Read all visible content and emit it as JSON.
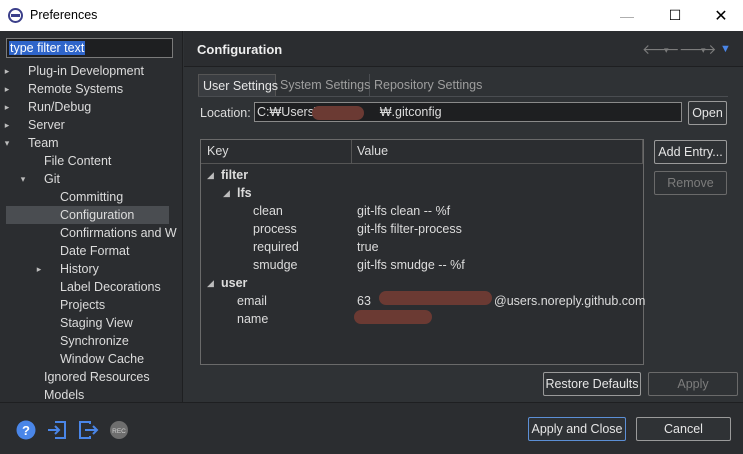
{
  "window": {
    "title": "Preferences",
    "minimize": "—",
    "maximize": "☐",
    "close": "✕"
  },
  "filter": {
    "text": "type filter text"
  },
  "tree": [
    {
      "label": "Plug-in Development",
      "depth": 0,
      "twisty": "▸"
    },
    {
      "label": "Remote Systems",
      "depth": 0,
      "twisty": "▸"
    },
    {
      "label": "Run/Debug",
      "depth": 0,
      "twisty": "▸"
    },
    {
      "label": "Server",
      "depth": 0,
      "twisty": "▸"
    },
    {
      "label": "Team",
      "depth": 0,
      "twisty": "▾"
    },
    {
      "label": "File Content",
      "depth": 1,
      "twisty": ""
    },
    {
      "label": "Git",
      "depth": 1,
      "twisty": "▾"
    },
    {
      "label": "Committing",
      "depth": 2,
      "twisty": ""
    },
    {
      "label": "Configuration",
      "depth": 2,
      "twisty": "",
      "selected": true
    },
    {
      "label": "Confirmations and W",
      "depth": 2,
      "twisty": ""
    },
    {
      "label": "Date Format",
      "depth": 2,
      "twisty": ""
    },
    {
      "label": "History",
      "depth": 2,
      "twisty": "▸"
    },
    {
      "label": "Label Decorations",
      "depth": 2,
      "twisty": ""
    },
    {
      "label": "Projects",
      "depth": 2,
      "twisty": ""
    },
    {
      "label": "Staging View",
      "depth": 2,
      "twisty": ""
    },
    {
      "label": "Synchronize",
      "depth": 2,
      "twisty": ""
    },
    {
      "label": "Window Cache",
      "depth": 2,
      "twisty": ""
    },
    {
      "label": "Ignored Resources",
      "depth": 1,
      "twisty": ""
    },
    {
      "label": "Models",
      "depth": 1,
      "twisty": ""
    }
  ],
  "page": {
    "title": "Configuration",
    "tabs": [
      "User Settings",
      "System Settings",
      "Repository Settings"
    ],
    "location_label": "Location:",
    "location_prefix": "C:₩Users₩",
    "location_suffix": "₩.gitconfig",
    "open_button": "Open",
    "add_entry_button": "Add Entry...",
    "remove_button": "Remove",
    "restore_defaults_button": "Restore Defaults",
    "apply_button": "Apply"
  },
  "table": {
    "headers": [
      "Key",
      "Value"
    ],
    "rows": [
      {
        "key": "filter",
        "value": "",
        "level": 0,
        "twisty": "◢",
        "bold": true
      },
      {
        "key": "lfs",
        "value": "",
        "level": 1,
        "twisty": "◢",
        "bold": true
      },
      {
        "key": "clean",
        "value": "git-lfs clean -- %f",
        "level": 2,
        "twisty": ""
      },
      {
        "key": "process",
        "value": "git-lfs filter-process",
        "level": 2,
        "twisty": ""
      },
      {
        "key": "required",
        "value": "true",
        "level": 2,
        "twisty": ""
      },
      {
        "key": "smudge",
        "value": "git-lfs smudge -- %f",
        "level": 2,
        "twisty": ""
      },
      {
        "key": "user",
        "value": "",
        "level": 0,
        "twisty": "◢",
        "bold": true
      },
      {
        "key": "email",
        "value": "63",
        "value_suffix": "@users.noreply.github.com",
        "level": 1,
        "twisty": ""
      },
      {
        "key": "name",
        "value": "",
        "level": 1,
        "twisty": ""
      }
    ]
  },
  "footer": {
    "apply_close_button": "Apply and Close",
    "cancel_button": "Cancel",
    "icons": [
      "help-icon",
      "import-icon",
      "export-icon",
      "record-icon"
    ],
    "rec_text": "REC"
  },
  "colors": {
    "accent": "#3d7be0",
    "redaction": "#6b3a33"
  }
}
